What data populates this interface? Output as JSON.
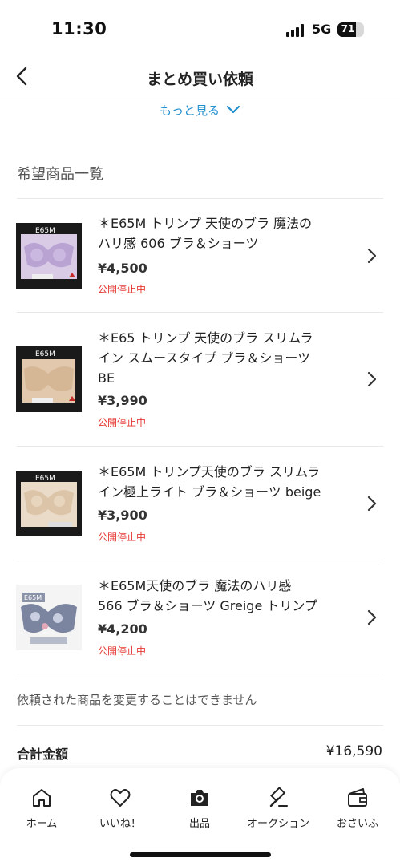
{
  "status_bar": {
    "time": "11:30",
    "network": "5G",
    "battery": "71",
    "battery_fraction": 0.71
  },
  "nav": {
    "title": "まとめ買い依頼"
  },
  "more_link": {
    "label": "もっと見る"
  },
  "section": {
    "title": "希望商品一覧"
  },
  "items": [
    {
      "title_line1": "＊E65M トリンプ 天使のブラ 魔法の",
      "title_line2": "ハリ感 606 ブラ＆ショーツ",
      "title_line3": "",
      "price": "¥4,500",
      "status": "公開停止中",
      "thumb_label": "E65M"
    },
    {
      "title_line1": "＊E65 トリンプ 天使のブラ スリムラ",
      "title_line2": "イン スムースタイプ ブラ＆ショーツ",
      "title_line3": "BE",
      "price": "¥3,990",
      "status": "公開停止中",
      "thumb_label": "E65M"
    },
    {
      "title_line1": "＊E65M トリンプ天使のブラ スリムラ",
      "title_line2": "イン極上ライト ブラ＆ショーツ beige",
      "title_line3": "",
      "price": "¥3,900",
      "status": "公開停止中",
      "thumb_label": "E65M"
    },
    {
      "title_line1": "＊E65M天使のブラ 魔法のハリ感",
      "title_line2": "566 ブラ＆ショーツ Greige トリンプ",
      "title_line3": "",
      "price": "¥4,200",
      "status": "公開停止中",
      "thumb_label": "E65M"
    }
  ],
  "notice": "依頼された商品を変更することはできません",
  "total": {
    "label": "合計金額",
    "value": "¥16,590"
  },
  "tabs": [
    {
      "label": "ホーム",
      "icon": "home-icon"
    },
    {
      "label": "いいね！",
      "icon": "heart-icon"
    },
    {
      "label": "出品",
      "icon": "camera-icon"
    },
    {
      "label": "オークション",
      "icon": "gavel-icon"
    },
    {
      "label": "おさいふ",
      "icon": "wallet-icon"
    }
  ],
  "colors": {
    "link": "#1f8fd0",
    "status_red": "#e53935",
    "text": "#222222"
  }
}
